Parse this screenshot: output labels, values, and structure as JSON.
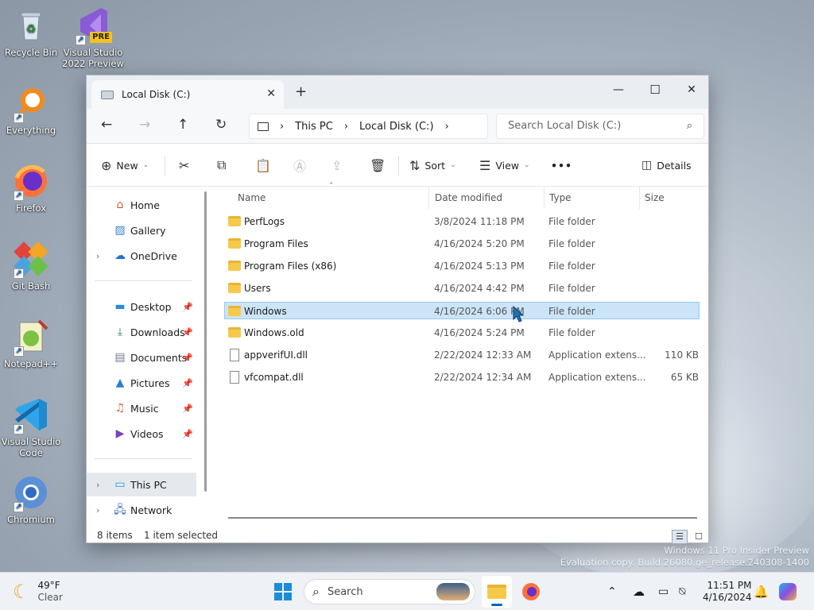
{
  "desktop": {
    "icons": [
      {
        "label": "Recycle Bin",
        "icon": "recycle-bin-icon"
      },
      {
        "label": "Visual Studio 2022 Preview",
        "icon": "visual-studio-icon",
        "badge": "PRE"
      },
      {
        "label": "Everything",
        "icon": "everything-search-icon"
      },
      {
        "label": "Firefox",
        "icon": "firefox-icon"
      },
      {
        "label": "Git Bash",
        "icon": "git-bash-icon"
      },
      {
        "label": "Notepad++",
        "icon": "notepad-plus-plus-icon"
      },
      {
        "label": "Visual Studio Code",
        "icon": "vscode-icon"
      },
      {
        "label": "Chromium",
        "icon": "chromium-icon"
      }
    ],
    "watermark_line1": "Windows 11 Pro Insider Preview",
    "watermark_line2": "Evaluation copy. Build 26080.ge_release.240308-1400"
  },
  "window": {
    "tab_title": "Local Disk (C:)",
    "tab_close": "✕",
    "new_tab": "+",
    "controls": {
      "minimize": "—",
      "maximize": "☐",
      "close": "✕"
    }
  },
  "nav": {
    "back": "←",
    "forward": "→",
    "up": "↑",
    "refresh": "↻",
    "breadcrumb": [
      "This PC",
      "Local Disk (C:)"
    ],
    "separator": "›",
    "search_placeholder": "Search Local Disk (C:)"
  },
  "toolbar": {
    "new_label": "New",
    "sort_label": "Sort",
    "view_label": "View",
    "more_label": "•••",
    "details_label": "Details"
  },
  "sidebar": {
    "top": [
      {
        "label": "Home",
        "icon": "home-icon"
      },
      {
        "label": "Gallery",
        "icon": "gallery-icon"
      },
      {
        "label": "OneDrive",
        "icon": "onedrive-icon"
      }
    ],
    "quick": [
      {
        "label": "Desktop",
        "icon": "desktop-folder-icon"
      },
      {
        "label": "Downloads",
        "icon": "download-icon"
      },
      {
        "label": "Documents",
        "icon": "documents-icon"
      },
      {
        "label": "Pictures",
        "icon": "pictures-icon"
      },
      {
        "label": "Music",
        "icon": "music-icon"
      },
      {
        "label": "Videos",
        "icon": "videos-icon"
      }
    ],
    "bottom": [
      {
        "label": "This PC",
        "icon": "this-pc-icon"
      },
      {
        "label": "Network",
        "icon": "network-icon"
      }
    ]
  },
  "columns": {
    "name": "Name",
    "date": "Date modified",
    "type": "Type",
    "size": "Size"
  },
  "files": [
    {
      "name": "PerfLogs",
      "date": "3/8/2024 11:18 PM",
      "type": "File folder",
      "size": "",
      "kind": "folder"
    },
    {
      "name": "Program Files",
      "date": "4/16/2024 5:20 PM",
      "type": "File folder",
      "size": "",
      "kind": "folder"
    },
    {
      "name": "Program Files (x86)",
      "date": "4/16/2024 5:13 PM",
      "type": "File folder",
      "size": "",
      "kind": "folder"
    },
    {
      "name": "Users",
      "date": "4/16/2024 4:42 PM",
      "type": "File folder",
      "size": "",
      "kind": "folder"
    },
    {
      "name": "Windows",
      "date": "4/16/2024 6:06 PM",
      "type": "File folder",
      "size": "",
      "kind": "folder",
      "selected": true
    },
    {
      "name": "Windows.old",
      "date": "4/16/2024 5:24 PM",
      "type": "File folder",
      "size": "",
      "kind": "folder"
    },
    {
      "name": "appverifUI.dll",
      "date": "2/22/2024 12:33 AM",
      "type": "Application extens...",
      "size": "110 KB",
      "kind": "file"
    },
    {
      "name": "vfcompat.dll",
      "date": "2/22/2024 12:34 AM",
      "type": "Application extens...",
      "size": "65 KB",
      "kind": "file"
    }
  ],
  "status": {
    "count": "8 items",
    "selected": "1 item selected"
  },
  "taskbar": {
    "weather_temp": "49°F",
    "weather_desc": "Clear",
    "search_label": "Search",
    "time": "11:51 PM",
    "date": "4/16/2024"
  },
  "colors": {
    "accent": "#0067c0",
    "selection": "#cce4f7",
    "folder": "#f7c94b"
  }
}
